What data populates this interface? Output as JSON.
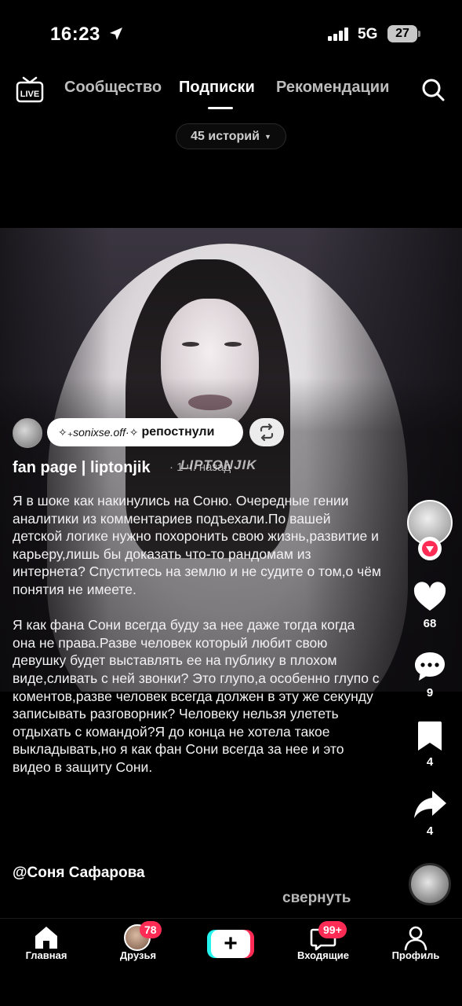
{
  "status_bar": {
    "time": "16:23",
    "network": "5G",
    "battery": "27",
    "icons": [
      "location-arrow-icon",
      "signal-icon",
      "battery-icon"
    ]
  },
  "top_nav": {
    "live_label": "LIVE",
    "tabs": [
      {
        "label": "Сообщество"
      },
      {
        "label": "Подписки"
      },
      {
        "label": "Рекомендации"
      }
    ],
    "active_tab": "Подписки",
    "stories": "45 историй"
  },
  "video": {
    "repost": {
      "handle": "✧₊sonixse.off·✧",
      "action": "репостнули"
    },
    "author": "fan page | liptonjik",
    "author_meta": "· 1 ч. назад",
    "watermark": "LIPTONJIK",
    "caption": [
      "Я в шоке как накинулись на Соню. Очередные гении аналитики из комментариев подъехали.По вашей детской логике нужно похоронить свою жизнь,развитие и карьеру,лишь бы доказать что-то рандомам из интернета? Спуститесь на землю и не судите о том,о чём понятия не имеете.",
      "Я как фана Сони всегда буду за нее даже тогда когда она не права.Разве человек который любит свою девушку будет выставлять ее на публику в плохом виде,сливать с ней звонки? Это глупо,а особенно глупо с коментов,разве человек всегда должен в эту же секунду записывать разговорник? Человеку нельзя улететь отдыхать с командой?Я до конца не хотела такое выкладывать,но я как фан Сони всегда за нее и это видео в защиту Сони."
    ],
    "mention": "@Соня Сафарова",
    "collapse_label": "свернуть"
  },
  "right_rail": {
    "likes": "68",
    "comments": "9",
    "saves": "4",
    "shares": "4"
  },
  "bottom_nav": {
    "items": [
      {
        "label": "Главная"
      },
      {
        "label": "Друзья",
        "badge": "78"
      },
      {
        "label": ""
      },
      {
        "label": "Входящие",
        "badge": "99+"
      },
      {
        "label": "Профиль"
      }
    ]
  },
  "colors": {
    "accent": "#fe2c55",
    "cyan": "#25f4ee",
    "background": "#000000"
  }
}
